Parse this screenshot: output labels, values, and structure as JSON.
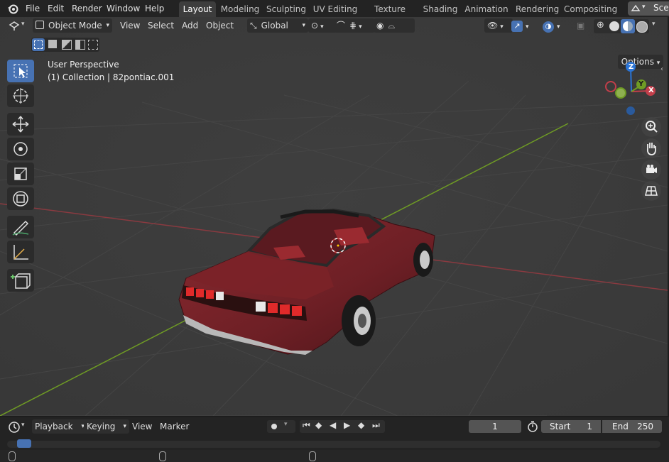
{
  "menu": [
    "File",
    "Edit",
    "Render",
    "Window",
    "Help"
  ],
  "workspaces": [
    "Layout",
    "Modeling",
    "Sculpting",
    "UV Editing",
    "Texture Paint",
    "Shading",
    "Animation",
    "Rendering",
    "Compositing"
  ],
  "scene_label": "Sce",
  "header": {
    "mode": "Object Mode",
    "view": "View",
    "select": "Select",
    "add": "Add",
    "object": "Object",
    "orientation": "Global",
    "options": "Options"
  },
  "overlay": {
    "perspective": "User Perspective",
    "collection": "(1) Collection | 82pontiac.001"
  },
  "gizmo": {
    "z": "Z",
    "y": "Y",
    "x": "X"
  },
  "timeline": {
    "playback": "Playback",
    "keying": "Keying",
    "view": "View",
    "marker": "Marker",
    "current_frame": "1",
    "start_label": "Start",
    "start_value": "1",
    "end_label": "End",
    "end_value": "250"
  },
  "colors": {
    "accent": "#4772b3",
    "x_axis": "#c23e4a",
    "y_axis": "#6f9c24",
    "z_axis": "#2a74d6",
    "car": "#7a2228"
  }
}
